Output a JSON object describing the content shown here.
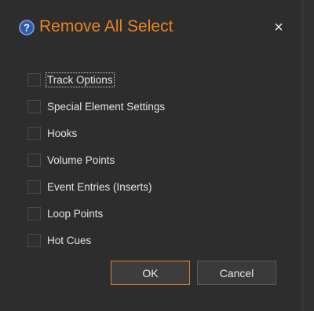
{
  "dialog": {
    "title": "Remove All Select",
    "help_icon": "question-circle-icon",
    "close_icon": "close-icon",
    "close_glyph": "×",
    "accent_color": "#e8851e"
  },
  "options": [
    {
      "label": "Track Options",
      "checked": false,
      "focused": true
    },
    {
      "label": "Special Element Settings",
      "checked": false
    },
    {
      "label": "Hooks",
      "checked": false
    },
    {
      "label": "Volume Points",
      "checked": false
    },
    {
      "label": "Event Entries (Inserts)",
      "checked": false
    },
    {
      "label": "Loop Points",
      "checked": false
    },
    {
      "label": "Hot Cues",
      "checked": false
    }
  ],
  "buttons": {
    "ok_label": "OK",
    "cancel_label": "Cancel"
  }
}
